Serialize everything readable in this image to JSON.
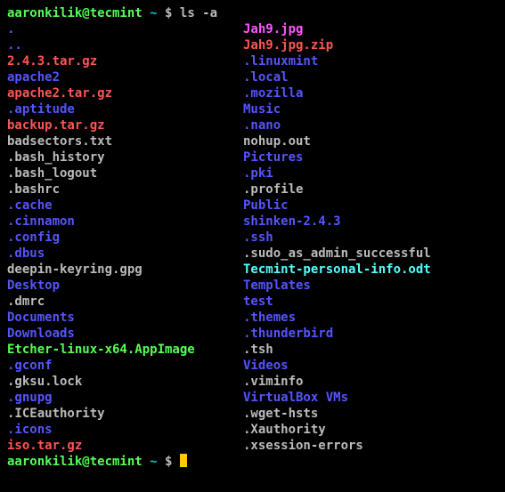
{
  "prompt": {
    "user": "aaronkilik@tecmint",
    "sep1": " ",
    "tilde": "~",
    "sep2": " $ ",
    "command": "ls -a"
  },
  "listing": [
    {
      "c1": {
        "text": ".",
        "cls": "c-dir"
      },
      "c2": {
        "text": "Jah9.jpg",
        "cls": "c-img"
      }
    },
    {
      "c1": {
        "text": "..",
        "cls": "c-dir"
      },
      "c2": {
        "text": "Jah9.jpg.zip",
        "cls": "c-arch"
      }
    },
    {
      "c1": {
        "text": "2.4.3.tar.gz",
        "cls": "c-arch"
      },
      "c2": {
        "text": ".linuxmint",
        "cls": "c-dir"
      }
    },
    {
      "c1": {
        "text": "apache2",
        "cls": "c-dir"
      },
      "c2": {
        "text": ".local",
        "cls": "c-dir"
      }
    },
    {
      "c1": {
        "text": "apache2.tar.gz",
        "cls": "c-arch"
      },
      "c2": {
        "text": ".mozilla",
        "cls": "c-dir"
      }
    },
    {
      "c1": {
        "text": ".aptitude",
        "cls": "c-dir"
      },
      "c2": {
        "text": "Music",
        "cls": "c-dir"
      }
    },
    {
      "c1": {
        "text": "backup.tar.gz",
        "cls": "c-arch"
      },
      "c2": {
        "text": ".nano",
        "cls": "c-dir"
      }
    },
    {
      "c1": {
        "text": "badsectors.txt",
        "cls": "c-plain"
      },
      "c2": {
        "text": "nohup.out",
        "cls": "c-plain"
      }
    },
    {
      "c1": {
        "text": ".bash_history",
        "cls": "c-plain"
      },
      "c2": {
        "text": "Pictures",
        "cls": "c-dir"
      }
    },
    {
      "c1": {
        "text": ".bash_logout",
        "cls": "c-plain"
      },
      "c2": {
        "text": ".pki",
        "cls": "c-dir"
      }
    },
    {
      "c1": {
        "text": ".bashrc",
        "cls": "c-plain"
      },
      "c2": {
        "text": ".profile",
        "cls": "c-plain"
      }
    },
    {
      "c1": {
        "text": ".cache",
        "cls": "c-dir"
      },
      "c2": {
        "text": "Public",
        "cls": "c-dir"
      }
    },
    {
      "c1": {
        "text": ".cinnamon",
        "cls": "c-dir"
      },
      "c2": {
        "text": "shinken-2.4.3",
        "cls": "c-dir"
      }
    },
    {
      "c1": {
        "text": ".config",
        "cls": "c-dir"
      },
      "c2": {
        "text": ".ssh",
        "cls": "c-dir"
      }
    },
    {
      "c1": {
        "text": ".dbus",
        "cls": "c-dir"
      },
      "c2": {
        "text": ".sudo_as_admin_successful",
        "cls": "c-plain"
      }
    },
    {
      "c1": {
        "text": "deepin-keyring.gpg",
        "cls": "c-plain"
      },
      "c2": {
        "text": "Tecmint-personal-info.odt",
        "cls": "c-link"
      }
    },
    {
      "c1": {
        "text": "Desktop",
        "cls": "c-dir"
      },
      "c2": {
        "text": "Templates",
        "cls": "c-dir"
      }
    },
    {
      "c1": {
        "text": ".dmrc",
        "cls": "c-plain"
      },
      "c2": {
        "text": "test",
        "cls": "c-dir"
      }
    },
    {
      "c1": {
        "text": "Documents",
        "cls": "c-dir"
      },
      "c2": {
        "text": ".themes",
        "cls": "c-dir"
      }
    },
    {
      "c1": {
        "text": "Downloads",
        "cls": "c-dir"
      },
      "c2": {
        "text": ".thunderbird",
        "cls": "c-dir"
      }
    },
    {
      "c1": {
        "text": "Etcher-linux-x64.AppImage",
        "cls": "c-exe"
      },
      "c2": {
        "text": ".tsh",
        "cls": "c-plain"
      }
    },
    {
      "c1": {
        "text": ".gconf",
        "cls": "c-dir"
      },
      "c2": {
        "text": "Videos",
        "cls": "c-dir"
      }
    },
    {
      "c1": {
        "text": ".gksu.lock",
        "cls": "c-plain"
      },
      "c2": {
        "text": ".viminfo",
        "cls": "c-plain"
      }
    },
    {
      "c1": {
        "text": ".gnupg",
        "cls": "c-dir"
      },
      "c2": {
        "text": "VirtualBox VMs",
        "cls": "c-dir"
      }
    },
    {
      "c1": {
        "text": ".ICEauthority",
        "cls": "c-plain"
      },
      "c2": {
        "text": ".wget-hsts",
        "cls": "c-plain"
      }
    },
    {
      "c1": {
        "text": ".icons",
        "cls": "c-dir"
      },
      "c2": {
        "text": ".Xauthority",
        "cls": "c-plain"
      }
    },
    {
      "c1": {
        "text": "iso.tar.gz",
        "cls": "c-arch"
      },
      "c2": {
        "text": ".xsession-errors",
        "cls": "c-plain"
      }
    }
  ]
}
